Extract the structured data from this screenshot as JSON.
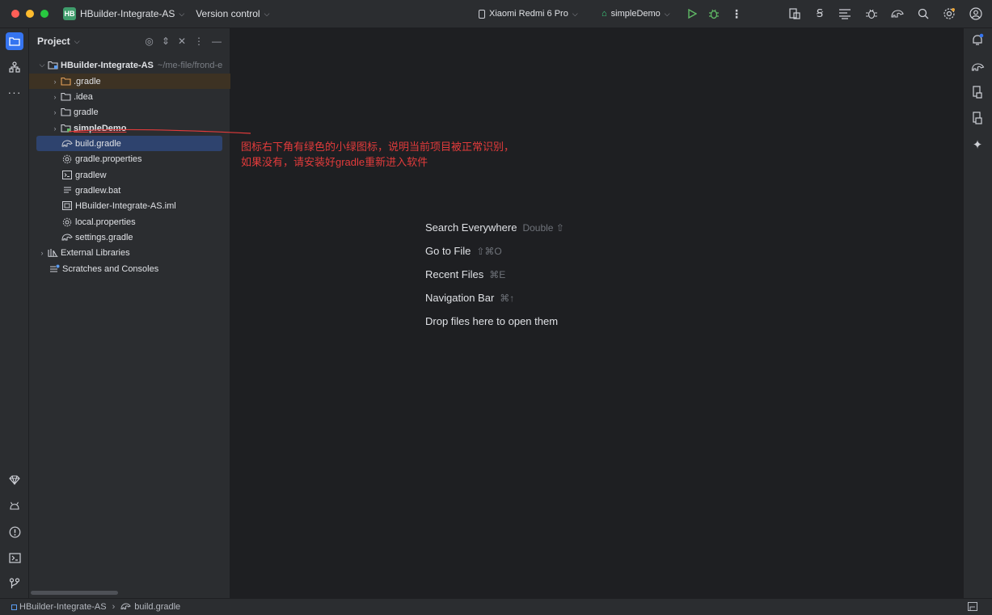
{
  "titlebar": {
    "project_badge": "HB",
    "project_name": "HBuilder-Integrate-AS",
    "vcs_label": "Version control",
    "device": "Xiaomi Redmi 6 Pro",
    "run_config": "simpleDemo"
  },
  "panel": {
    "title": "Project",
    "tree": [
      {
        "label": "HBuilder-Integrate-AS",
        "extra": "~/me-file/frond-e",
        "bold": true
      },
      {
        "label": ".gradle"
      },
      {
        "label": ".idea"
      },
      {
        "label": "gradle"
      },
      {
        "label": "simpleDemo",
        "bold": true
      },
      {
        "label": "build.gradle"
      },
      {
        "label": "gradle.properties"
      },
      {
        "label": "gradlew"
      },
      {
        "label": "gradlew.bat"
      },
      {
        "label": "HBuilder-Integrate-AS.iml"
      },
      {
        "label": "local.properties"
      },
      {
        "label": "settings.gradle"
      },
      {
        "label": "External Libraries"
      },
      {
        "label": "Scratches and Consoles"
      }
    ]
  },
  "annotation": {
    "line1": "图标右下角有绿色的小绿图标，说明当前项目被正常识别，",
    "line2": "如果没有，请安装好gradle重新进入软件"
  },
  "editor_hints": [
    {
      "label": "Search Everywhere",
      "shortcut": "Double ⇧"
    },
    {
      "label": "Go to File",
      "shortcut": "⇧⌘O"
    },
    {
      "label": "Recent Files",
      "shortcut": "⌘E"
    },
    {
      "label": "Navigation Bar",
      "shortcut": "⌘↑"
    },
    {
      "label": "Drop files here to open them",
      "shortcut": ""
    }
  ],
  "statusbar": {
    "crumb_project": "HBuilder-Integrate-AS",
    "crumb_file": "build.gradle"
  },
  "colors": {
    "accent": "#3574f0",
    "annotation": "#e23b3b",
    "badge": "#3f9d6c"
  }
}
